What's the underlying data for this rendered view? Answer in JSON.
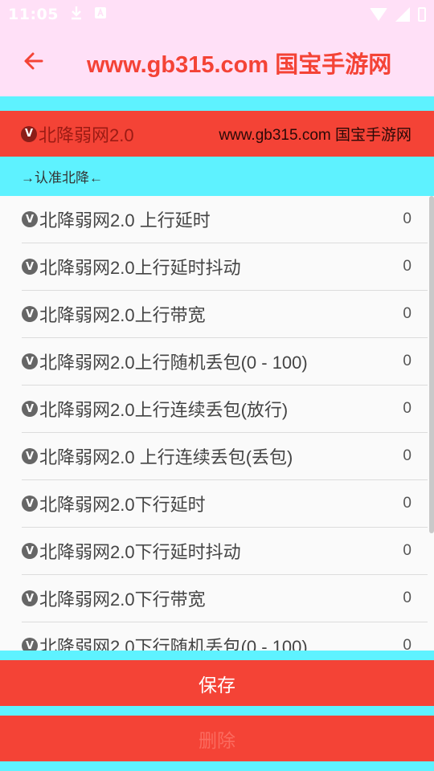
{
  "status_bar": {
    "time": "11:05",
    "icons": [
      "download-icon",
      "a-icon"
    ],
    "right_icons": [
      "wifi-icon",
      "signal-icon",
      "battery-icon"
    ]
  },
  "app_bar": {
    "title": "www.gb315.com 国宝手游网",
    "back_icon": "arrow-left-icon"
  },
  "banner": {
    "badge": "V",
    "title": "北降弱网2.0",
    "site": "www.gb315.com 国宝手游网"
  },
  "hint": "→认准北降←",
  "list": {
    "items": [
      {
        "badge": "V",
        "label": "北降弱网2.0 上行延时",
        "value": "0"
      },
      {
        "badge": "V",
        "label": "北降弱网2.0上行延时抖动",
        "value": "0"
      },
      {
        "badge": "V",
        "label": "北降弱网2.0上行带宽",
        "value": "0"
      },
      {
        "badge": "V",
        "label": "北降弱网2.0上行随机丢包(0 - 100)",
        "value": "0"
      },
      {
        "badge": "V",
        "label": "北降弱网2.0上行连续丢包(放行)",
        "value": "0"
      },
      {
        "badge": "V",
        "label": "北降弱网2.0 上行连续丢包(丢包)",
        "value": "0"
      },
      {
        "badge": "V",
        "label": "北降弱网2.0下行延时",
        "value": "0"
      },
      {
        "badge": "V",
        "label": "北降弱网2.0下行延时抖动",
        "value": "0"
      },
      {
        "badge": "V",
        "label": "北降弱网2.0下行带宽",
        "value": "0"
      },
      {
        "badge": "V",
        "label": "北降弱网2.0下行随机丢包(0 - 100)",
        "value": "0"
      }
    ]
  },
  "buttons": {
    "save": "保存",
    "delete": "删除"
  },
  "colors": {
    "accent": "#f44336",
    "cyan": "#5ef2ff",
    "pink": "#ffe0f7"
  }
}
